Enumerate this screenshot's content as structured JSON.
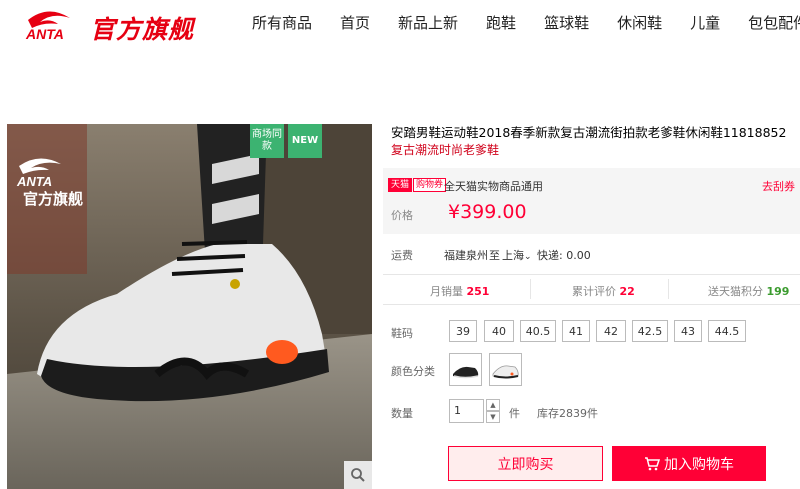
{
  "header": {
    "brand_text": "ANTA",
    "store_text": "官方旗舰",
    "nav": [
      "所有商品",
      "首页",
      "新品上新",
      "跑鞋",
      "篮球鞋",
      "休闲鞋",
      "儿童",
      "包包配件"
    ]
  },
  "gallery": {
    "badge_same": "商场同款",
    "badge_new": "NEW",
    "watermark_brand": "ANTA",
    "watermark_store": "官方旗舰"
  },
  "product": {
    "title": "安踏男鞋运动鞋2018春季新款复古潮流街拍款老爹鞋休闲鞋11818852",
    "subtitle": "复古潮流时尚老爹鞋",
    "tag_tmall": "天猫",
    "tag_coupon": "购物券",
    "promo_text": "全天猫实物商品通用",
    "get_coupon": "去刮券",
    "price_label": "价格",
    "price": "¥399.00",
    "shipping_label": "运费",
    "ship_from": "福建泉州",
    "ship_to_prefix": "至",
    "ship_to": "上海",
    "express": "快递: 0.00",
    "stats": {
      "monthly_sales_label": "月销量",
      "monthly_sales_value": "251",
      "reviews_label": "累计评价",
      "reviews_value": "22",
      "points_label": "送天猫积分",
      "points_value": "199"
    },
    "size_label": "鞋码",
    "sizes": [
      "39",
      "40",
      "40.5",
      "41",
      "42",
      "42.5",
      "43",
      "44.5"
    ],
    "color_label": "颜色分类",
    "qty_label": "数量",
    "qty_value": "1",
    "qty_unit": "件",
    "stock": "库存2839件",
    "buy_now": "立即购买",
    "add_to_cart": "加入购物车"
  },
  "colors": {
    "accent": "#ff0036",
    "header_red": "#e60012",
    "badge_green": "#3cb371"
  }
}
